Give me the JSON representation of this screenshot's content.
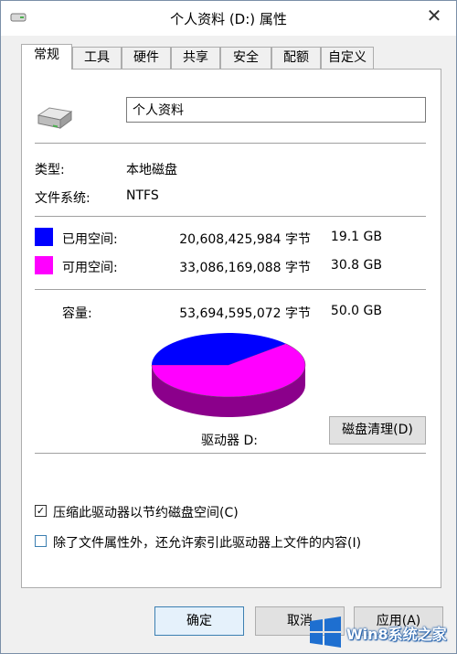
{
  "window": {
    "title": "个人资料 (D:) 属性",
    "close_label": "✕"
  },
  "tabs": [
    {
      "label": "常规",
      "active": true
    },
    {
      "label": "工具"
    },
    {
      "label": "硬件"
    },
    {
      "label": "共享"
    },
    {
      "label": "安全"
    },
    {
      "label": "配额"
    },
    {
      "label": "自定义"
    }
  ],
  "general": {
    "drive_name_value": "个人资料",
    "type_label": "类型:",
    "type_value": "本地磁盘",
    "fs_label": "文件系统:",
    "fs_value": "NTFS",
    "used": {
      "label": "已用空间:",
      "bytes": "20,608,425,984 字节",
      "size": "19.1 GB",
      "color": "#0000ff"
    },
    "free": {
      "label": "可用空间:",
      "bytes": "33,086,169,088 字节",
      "size": "30.8 GB",
      "color": "#ff00ff"
    },
    "capacity": {
      "label": "容量:",
      "bytes": "53,694,595,072 字节",
      "size": "50.0 GB"
    },
    "drive_label": "驱动器 D:",
    "cleanup_button": "磁盘清理(D)",
    "usage": {
      "used_fraction": 0.384,
      "free_fraction": 0.616
    },
    "compress_checkbox": {
      "label": "压缩此驱动器以节约磁盘空间(C)",
      "checked": true
    },
    "index_checkbox": {
      "label": "除了文件属性外，还允许索引此驱动器上文件的内容(I)",
      "checked": false
    }
  },
  "buttons": {
    "ok": "确定",
    "cancel": "取消",
    "apply": "应用(A)"
  },
  "watermark": {
    "text": "Win8系统之家"
  }
}
